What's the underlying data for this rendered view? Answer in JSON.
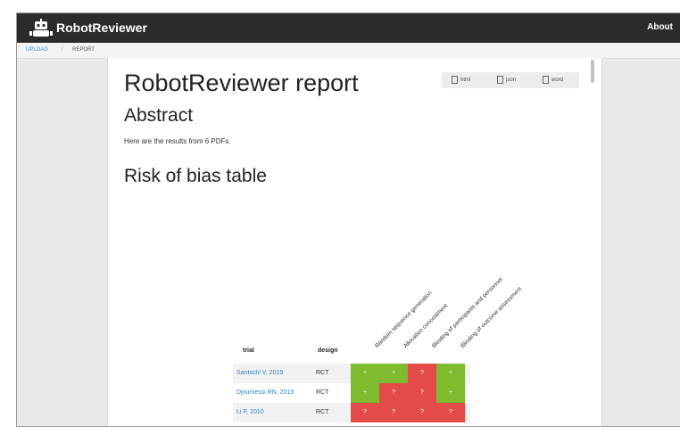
{
  "app": {
    "brand": "RobotReviewer",
    "about_link": "About"
  },
  "breadcrumb": {
    "upload": "UPLOAD",
    "separator": "/",
    "report": "REPORT"
  },
  "report": {
    "title": "RobotReviewer report",
    "downloads": [
      "html",
      "json",
      "word"
    ],
    "abstract_heading": "Abstract",
    "abstract_text": "Here are the results from 6 PDFs.",
    "rob_heading": "Risk of bias table"
  },
  "table": {
    "columns": {
      "trial": "trial",
      "design": "design"
    },
    "domains": [
      "Random sequence generation",
      "Allocation concealment",
      "Blinding of participants and personnel",
      "Blinding of outcome assessment"
    ],
    "rows": [
      {
        "trial": "Santschi V, 2015",
        "design": "RCT",
        "judgements": [
          "+",
          "+",
          "?",
          "+"
        ]
      },
      {
        "trial": "Djoumessi RN, 2013",
        "design": "RCT",
        "judgements": [
          "+",
          "?",
          "?",
          "+"
        ]
      },
      {
        "trial": "Li P, 2010",
        "design": "RCT",
        "judgements": [
          "?",
          "?",
          "?",
          "?"
        ]
      }
    ],
    "colors": {
      "low": "#7fba2f",
      "unclear": "#e44a47"
    }
  }
}
